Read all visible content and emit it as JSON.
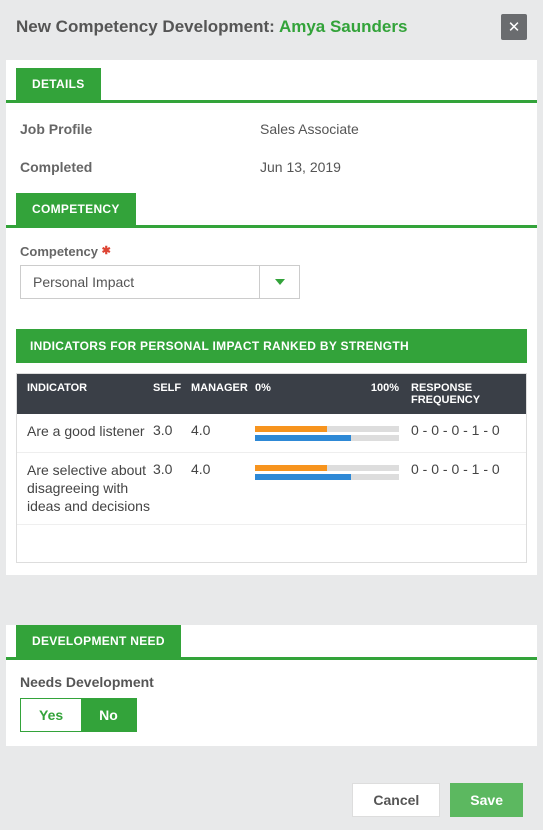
{
  "header": {
    "title_prefix": "New Competency Development: ",
    "person_name": "Amya Saunders"
  },
  "tabs": {
    "details": "DETAILS",
    "competency": "COMPETENCY",
    "dev_need": "DEVELOPMENT NEED"
  },
  "details": {
    "job_profile_label": "Job Profile",
    "job_profile_value": "Sales Associate",
    "completed_label": "Completed",
    "completed_value": "Jun 13, 2019"
  },
  "competency_field": {
    "label": "Competency",
    "value": "Personal Impact"
  },
  "indicators": {
    "header": "INDICATORS FOR PERSONAL IMPACT RANKED BY STRENGTH",
    "cols": {
      "indicator": "INDICATOR",
      "self": "SELF",
      "manager": "MANAGER",
      "pct0": "0%",
      "pct100": "100%",
      "freq": "RESPONSE FREQUENCY"
    },
    "rows": [
      {
        "indicator": "Are a good listener",
        "self": "3.0",
        "manager": "4.0",
        "self_pct": 50,
        "mgr_pct": 67,
        "freq": "0 - 0 - 0 - 1 - 0"
      },
      {
        "indicator": "Are selective about disagreeing with ideas and decisions",
        "self": "3.0",
        "manager": "4.0",
        "self_pct": 50,
        "mgr_pct": 67,
        "freq": "0 - 0 - 0 - 1 - 0"
      }
    ]
  },
  "dev_need": {
    "label": "Needs Development",
    "yes": "Yes",
    "no": "No"
  },
  "footer": {
    "cancel": "Cancel",
    "save": "Save"
  }
}
